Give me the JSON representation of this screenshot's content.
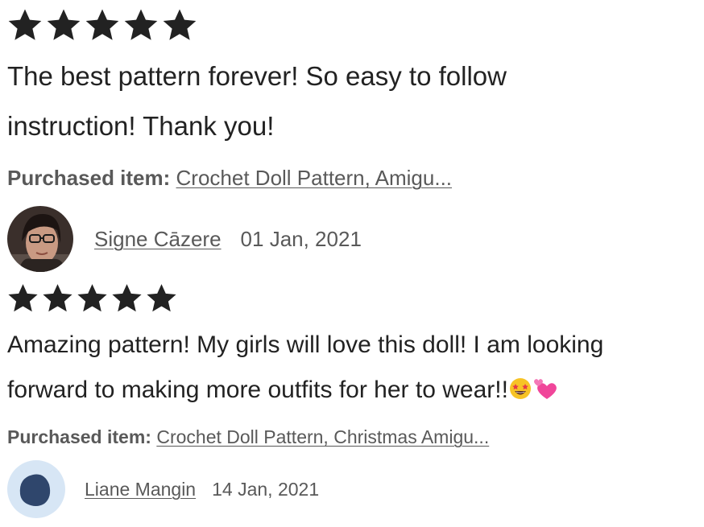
{
  "reviews": [
    {
      "rating": 5,
      "text_line1": "The best pattern forever! So easy to follow",
      "text_line2": "instruction! Thank you!",
      "purchased_label": "Purchased item:",
      "purchased_item": "Crochet Doll Pattern, Amigu...",
      "author": "Signe Cāzere",
      "date": "01 Jan, 2021",
      "avatar": "user-photo-avatar"
    },
    {
      "rating": 5,
      "text_line1": "Amazing pattern! My girls will love this doll! I am looking",
      "text_line2": "forward to making more outfits for her to wear!!",
      "emojis": [
        "star-struck-emoji",
        "two-hearts-emoji"
      ],
      "purchased_label": "Purchased item:",
      "purchased_item": "Crochet Doll Pattern, Christmas Amigu...",
      "author": "Liane Mangin",
      "date": "14 Jan, 2021",
      "avatar": "default-avatar"
    }
  ],
  "colors": {
    "star": "#222222",
    "text": "#222222",
    "muted": "#595959",
    "default_avatar_bg": "#d7e6f5",
    "default_avatar_shape": "#2f466c"
  }
}
